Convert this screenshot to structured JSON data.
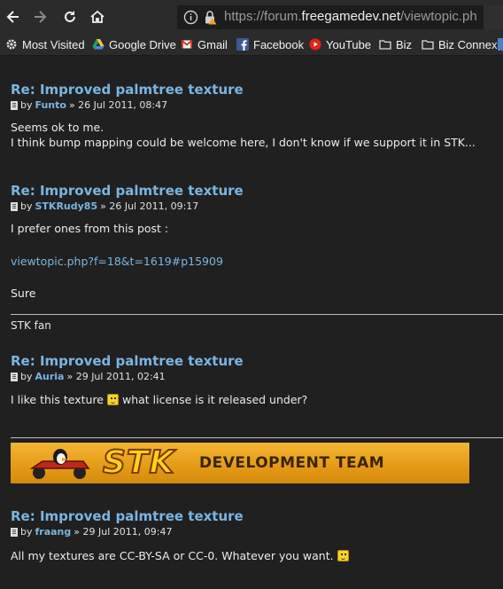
{
  "browser": {
    "url_prefix": "https://forum.",
    "url_domain": "freegamedev.net",
    "url_path": "/viewtopic.ph",
    "bookmarks": [
      {
        "label": "Most Visited",
        "icon": "gear-icon"
      },
      {
        "label": "Google Drive",
        "icon": "google-drive-icon"
      },
      {
        "label": "Gmail",
        "icon": "gmail-icon"
      },
      {
        "label": "Facebook",
        "icon": "facebook-icon"
      },
      {
        "label": "YouTube",
        "icon": "youtube-icon"
      },
      {
        "label": "Biz",
        "icon": "folder-icon"
      },
      {
        "label": "Biz Connex",
        "icon": "folder-icon"
      }
    ]
  },
  "posts": [
    {
      "title": "Re: Improved palmtree texture",
      "by": "by",
      "author": "Funto",
      "date": "» 26 Jul 2011, 08:47",
      "lines": [
        "Seems ok to me.",
        "I think bump mapping could be welcome here, I don't know if we support it in STK..."
      ]
    },
    {
      "title": "Re: Improved palmtree texture",
      "by": "by",
      "author": "STKRudy85",
      "date": "» 26 Jul 2011, 09:17",
      "line1": "I prefer ones from this post :",
      "link": "viewtopic.php?f=18&t=1619#p15909",
      "line2": "Sure",
      "signature": "STK fan"
    },
    {
      "title": "Re: Improved palmtree texture",
      "by": "by",
      "author": "Auria",
      "date": "» 29 Jul 2011, 02:41",
      "text_before": "I like this texture",
      "text_after": "what license is it released under?",
      "banner_logo": "STK",
      "banner_text": "DEVELOPMENT TEAM"
    },
    {
      "title": "Re: Improved palmtree texture",
      "by": "by",
      "author": "fraang",
      "date": "» 29 Jul 2011, 09:47",
      "text": "All my textures are CC-BY-SA or CC-0. Whatever you want."
    }
  ],
  "colors": {
    "link": "#79b6e2",
    "background": "#202020",
    "toolbar": "#2b2b2b"
  }
}
